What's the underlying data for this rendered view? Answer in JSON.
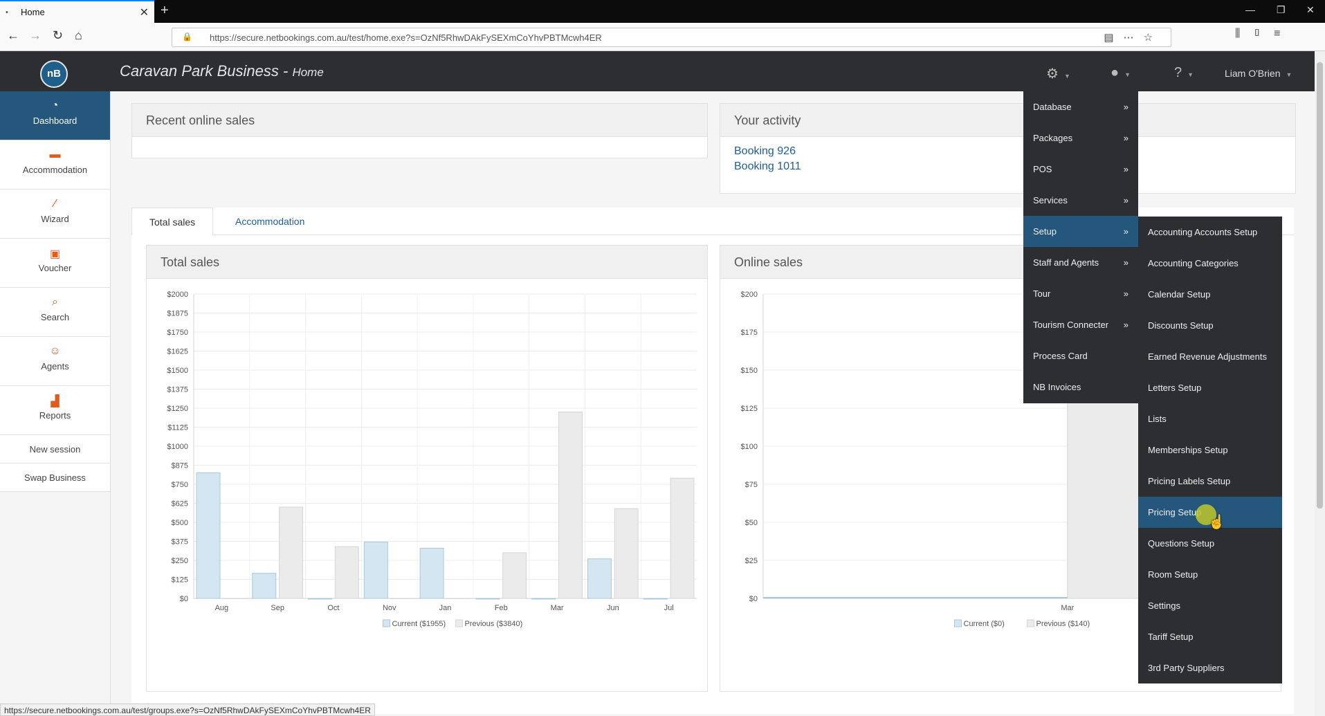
{
  "browser": {
    "tab_title": "Home",
    "tab_bullet": "•",
    "url": "https://secure.netbookings.com.au/test/home.exe?s=OzNf5RhwDAkFySEXmCoYhvPBTMcwh4ER",
    "status_url": "https://secure.netbookings.com.au/test/groups.exe?s=OzNf5RhwDAkFySEXmCoYhvPBTMcwh4ER"
  },
  "header": {
    "logo_text": "nB",
    "app_title": "Caravan Park Business - ",
    "page_name": "Home",
    "user_name": "Liam O'Brien"
  },
  "sidebar": {
    "items": [
      {
        "label": "Dashboard",
        "icon": "dashboard-icon"
      },
      {
        "label": "Accommodation",
        "icon": "bed-icon"
      },
      {
        "label": "Wizard",
        "icon": "wand-icon"
      },
      {
        "label": "Voucher",
        "icon": "gift-icon"
      },
      {
        "label": "Search",
        "icon": "search-icon"
      },
      {
        "label": "Agents",
        "icon": "agent-icon"
      },
      {
        "label": "Reports",
        "icon": "chart-icon"
      }
    ],
    "links": [
      "New session",
      "Swap Business"
    ]
  },
  "panels": {
    "recent_online_sales": "Recent online sales",
    "your_activity": "Your activity",
    "activity_links": [
      "Booking 926",
      "Booking 1011"
    ]
  },
  "tabs": [
    "Total sales",
    "Accommodation"
  ],
  "menu": {
    "level1": [
      {
        "label": "Database",
        "arrow": "»"
      },
      {
        "label": "Packages",
        "arrow": "»"
      },
      {
        "label": "POS",
        "arrow": "»"
      },
      {
        "label": "Services",
        "arrow": "»"
      },
      {
        "label": "Setup",
        "arrow": "»"
      },
      {
        "label": "Staff and Agents",
        "arrow": "»"
      },
      {
        "label": "Tour",
        "arrow": "»"
      },
      {
        "label": "Tourism Connecter",
        "arrow": "»"
      },
      {
        "label": "Process Card",
        "arrow": ""
      },
      {
        "label": "NB Invoices",
        "arrow": ""
      }
    ],
    "level1_active": "Setup",
    "level2": [
      "Accounting Accounts Setup",
      "Accounting Categories",
      "Calendar Setup",
      "Discounts Setup",
      "Earned Revenue Adjustments",
      "Letters Setup",
      "Lists",
      "Memberships Setup",
      "Pricing Labels Setup",
      "Pricing Setup",
      "Questions Setup",
      "Room Setup",
      "Settings",
      "Tariff Setup",
      "3rd Party Suppliers"
    ],
    "level2_active": "Pricing Setup"
  },
  "colors": {
    "current": "#d4e6f1",
    "current_stroke": "#a9c8da",
    "previous": "#ebebeb",
    "previous_stroke": "#d6d6d6",
    "menu_bg": "#2d2e32",
    "menu_active": "#25577d"
  },
  "chart_data": [
    {
      "type": "bar",
      "title": "Total sales",
      "categories": [
        "Aug",
        "Sep",
        "Oct",
        "Nov",
        "Jan",
        "Feb",
        "Mar",
        "Jun",
        "Jul"
      ],
      "series": [
        {
          "name": "Current ($1955)",
          "values": [
            825,
            165,
            0,
            370,
            330,
            0,
            0,
            260,
            0
          ]
        },
        {
          "name": "Previous ($3840)",
          "values": [
            0,
            600,
            340,
            0,
            0,
            300,
            1225,
            590,
            790
          ]
        }
      ],
      "yticks": [
        "$0",
        "$125",
        "$250",
        "$375",
        "$500",
        "$625",
        "$750",
        "$875",
        "$1000",
        "$1125",
        "$1250",
        "$1375",
        "$1500",
        "$1625",
        "$1750",
        "$1875",
        "$2000"
      ],
      "ylim": [
        0,
        2000
      ]
    },
    {
      "type": "bar",
      "title": "Online sales",
      "categories": [
        "Mar"
      ],
      "series": [
        {
          "name": "Current ($0)",
          "values": [
            0
          ]
        },
        {
          "name": "Previous ($140)",
          "values": [
            140
          ]
        }
      ],
      "yticks": [
        "$0",
        "$25",
        "$50",
        "$75",
        "$100",
        "$125",
        "$150",
        "$175",
        "$200"
      ],
      "ylim": [
        0,
        200
      ]
    }
  ]
}
